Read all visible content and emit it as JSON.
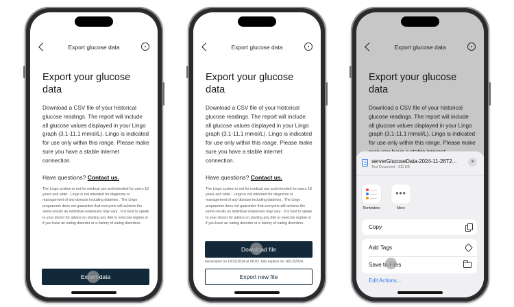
{
  "nav": {
    "title": "Export glucose data"
  },
  "page": {
    "heading": "Export your glucose data",
    "description": "Download a CSV file of your historical glucose readings. The report will include all glucose values displayed in your Lingo graph (3.1-11.1 mmol/L). Lingo is indicated for use only within this range. Please make sure you have a stable internet connection.",
    "questions_prefix": "Have questions?",
    "contact_link": "Contact us.",
    "disclaimer": "The Lingo system is not for medical use and intended for users 18 years and older . Lingo is not intended for diagnosis or management of any disease including diabetes . The Lingo programme does not guarantee that everyone will achieve the same results as individual responses may vary . It is best to speak to your doctor for advice on starting any diet or exercise regime or if you have an eating disorder or a history of eating disorders."
  },
  "screen1": {
    "export_button": "Export data"
  },
  "screen2": {
    "download_button": "Download file",
    "generated_note": "Generated on 18/11/2024 at 08:02. File expires on 18/12/2024.",
    "export_new_button": "Export new file"
  },
  "share_sheet": {
    "file_name": "serverGlucoseData-2024-11-26T2...",
    "file_meta": "Text Document · 611 KB",
    "close_icon": "close-icon",
    "apps": [
      {
        "label": "Reminders",
        "icon": "reminders-icon"
      },
      {
        "label": "More",
        "icon": "more-icon"
      }
    ],
    "actions": [
      {
        "label": "Copy",
        "icon": "copy-icon"
      },
      {
        "label": "Add Tags",
        "icon": "tag-icon"
      },
      {
        "label": "Save to Files",
        "icon": "folder-icon"
      }
    ],
    "edit_actions": "Edit Actions..."
  },
  "colors": {
    "primary_button": "#12293a",
    "link_blue": "#2d7be5",
    "sheet_background": "#f0f0f3"
  }
}
